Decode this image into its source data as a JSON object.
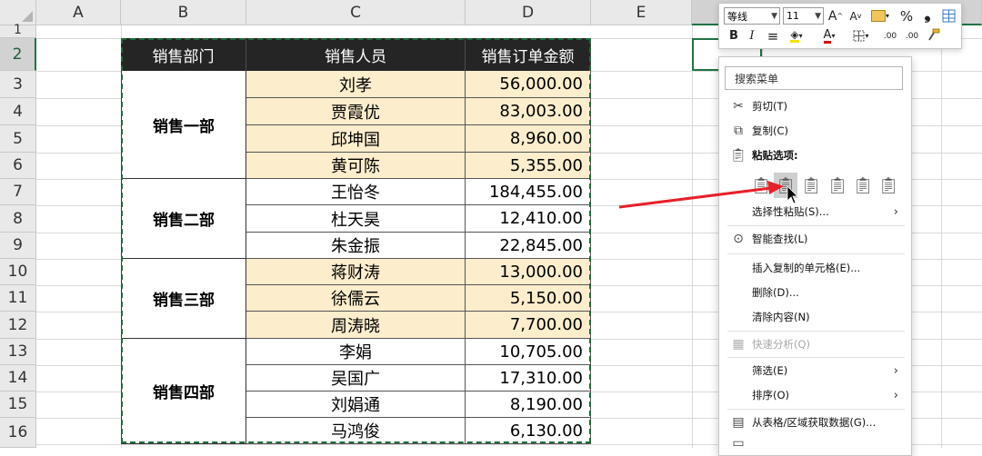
{
  "columns": [
    "A",
    "B",
    "C",
    "D",
    "E"
  ],
  "rows": [
    "1",
    "2",
    "3",
    "4",
    "5",
    "6",
    "7",
    "8",
    "9",
    "10",
    "11",
    "12",
    "13",
    "14",
    "15",
    "16"
  ],
  "table": {
    "headers": [
      "销售部门",
      "销售人员",
      "销售订单金额"
    ],
    "departments": [
      "销售一部",
      "销售二部",
      "销售三部",
      "销售四部"
    ],
    "records": [
      {
        "name": "刘孝",
        "amount": "56,000.00"
      },
      {
        "name": "贾霞优",
        "amount": "83,003.00"
      },
      {
        "name": "邱坤国",
        "amount": "8,960.00"
      },
      {
        "name": "黄可陈",
        "amount": "5,355.00"
      },
      {
        "name": "王怡冬",
        "amount": "184,455.00"
      },
      {
        "name": "杜天昊",
        "amount": "12,410.00"
      },
      {
        "name": "朱金振",
        "amount": "22,845.00"
      },
      {
        "name": "蒋财涛",
        "amount": "13,000.00"
      },
      {
        "name": "徐儒云",
        "amount": "5,150.00"
      },
      {
        "name": "周涛晓",
        "amount": "7,700.00"
      },
      {
        "name": "李娟",
        "amount": "10,705.00"
      },
      {
        "name": "吴国广",
        "amount": "17,310.00"
      },
      {
        "name": "刘娟通",
        "amount": "8,190.00"
      },
      {
        "name": "马鸿俊",
        "amount": "6,130.00"
      }
    ]
  },
  "mini_toolbar": {
    "font_name": "等线",
    "font_size": "11",
    "grow": "A",
    "shrink": "A",
    "percent": "%",
    "comma": "❟",
    "bold": "B",
    "italic": "I",
    "font_color_letter": "A",
    "decimals": ".00"
  },
  "context_menu": {
    "search_placeholder": "搜索菜单",
    "cut": "剪切(T)",
    "copy": "复制(C)",
    "paste_options": "粘贴选项:",
    "paste_special": "选择性粘贴(S)...",
    "smart_lookup": "智能查找(L)",
    "insert_copied": "插入复制的单元格(E)...",
    "delete": "删除(D)...",
    "clear": "清除内容(N)",
    "quick_analysis": "快速分析(Q)",
    "filter": "筛选(E)",
    "sort": "排序(O)",
    "from_table": "从表格/区域获取数据(G)..."
  },
  "colors": {
    "accent": "#217346",
    "header_bg": "#252525",
    "row_fill": "#fcedcc",
    "arrow": "#e8202a"
  },
  "icons": [
    "scissors-icon",
    "copy-icon",
    "clipboard-icon",
    "paste-icon",
    "paste-values-icon",
    "paste-formulas-icon",
    "paste-transpose-icon",
    "paste-formatting-icon",
    "paste-link-icon",
    "lookup-icon",
    "quick-analysis-icon",
    "table-icon",
    "chevron-right-icon",
    "arrow-icon"
  ]
}
